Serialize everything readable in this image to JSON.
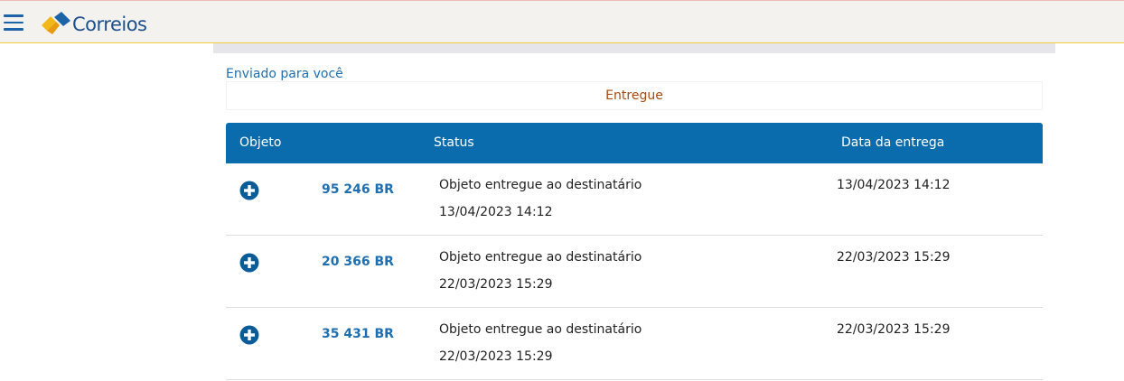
{
  "brand": {
    "name": "Correios"
  },
  "section": {
    "title": "Enviado para você",
    "status_filter": "Entregue"
  },
  "table": {
    "headers": {
      "object": "Objeto",
      "status": "Status",
      "delivery_date": "Data da entrega"
    },
    "rows": [
      {
        "code": "95 246 BR",
        "status": "Objeto entregue ao destinatário",
        "status_date": "13/04/2023 14:12",
        "delivery_date": "13/04/2023 14:12"
      },
      {
        "code": "20 366 BR",
        "status": "Objeto entregue ao destinatário",
        "status_date": "22/03/2023 15:29",
        "delivery_date": "22/03/2023 15:29"
      },
      {
        "code": "35 431 BR",
        "status": "Objeto entregue ao destinatário",
        "status_date": "22/03/2023 15:29",
        "delivery_date": "22/03/2023 15:29"
      }
    ]
  },
  "colors": {
    "header_blue": "#0a6cac",
    "link_blue": "#1f6fb0",
    "status_orange": "#a64a12",
    "brand_yellow": "#f2b81a"
  },
  "icons": {
    "menu": "hamburger-menu-icon",
    "expand": "plus-circle-icon"
  }
}
